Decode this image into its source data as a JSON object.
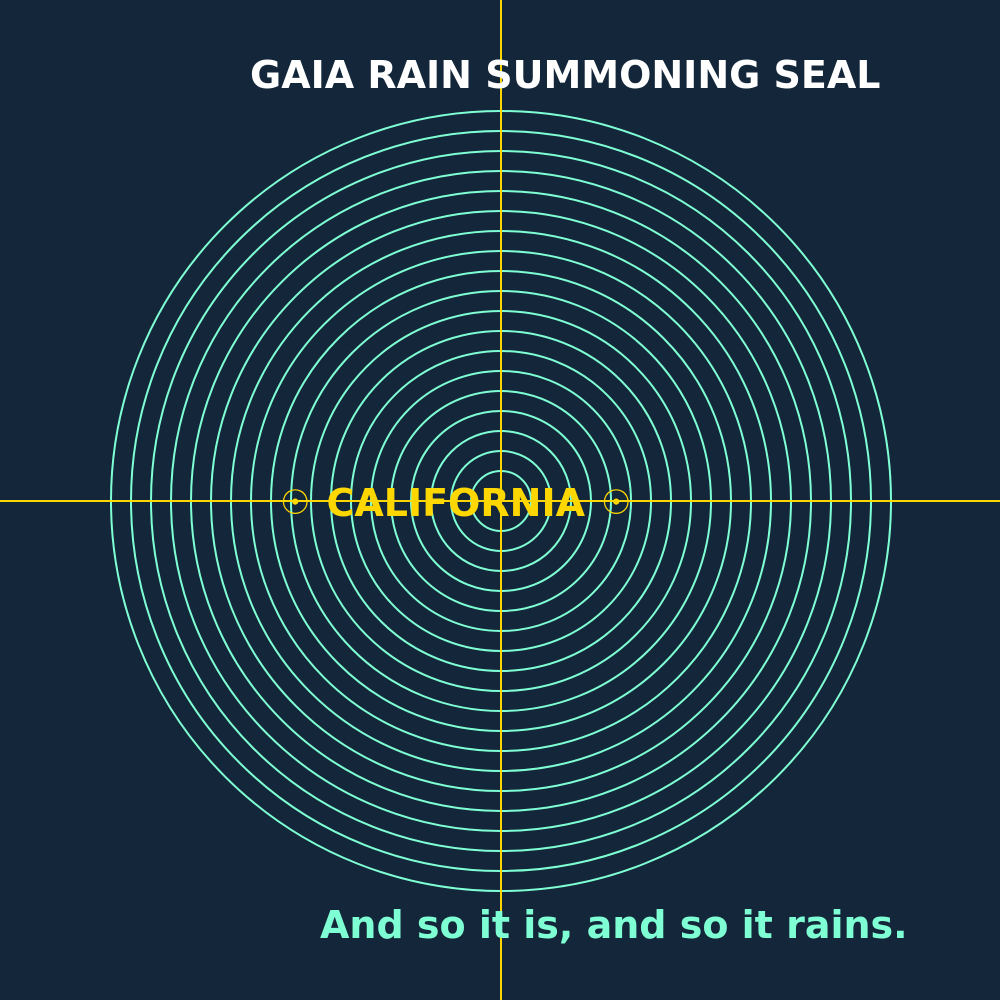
{
  "seal": {
    "title": "GAIA RAIN SUMMONING SEAL",
    "center_label": "CALIFORNIA",
    "center_glyph": "☉",
    "blessing": "And so it is, and so it rains.",
    "colors": {
      "background": "#14273a",
      "rings": "#7fffd4",
      "axes": "#ffd700",
      "title": "#ffffff",
      "center_label": "#ffd700",
      "blessing": "#7fffd4"
    },
    "icons": {
      "rings": "concentric-rings-icon",
      "axes": "crosshair-icon",
      "glyph": "sun-symbol-icon"
    }
  }
}
